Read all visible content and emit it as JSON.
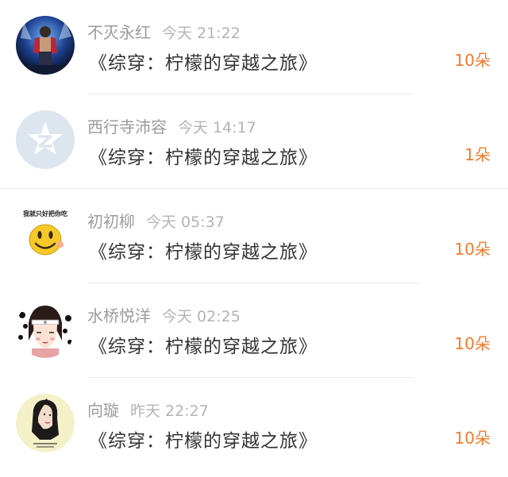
{
  "accent_color": "#f07a2c",
  "items": [
    {
      "avatar_icon": "performer-avatar-icon",
      "name": "不灭永红",
      "time": "今天 21:22",
      "book": "《综穿：柠檬的穿越之旅》",
      "count": "10朵"
    },
    {
      "avatar_icon": "default-star-avatar-icon",
      "name": "西行寺沛容",
      "time": "今天 14:17",
      "book": "《综穿：柠檬的穿越之旅》",
      "count": "1朵"
    },
    {
      "avatar_icon": "smiley-avatar-icon",
      "avatar_caption": "我就只好把你吃",
      "name": "初初柳",
      "time": "今天 05:37",
      "book": "《综穿：柠檬的穿越之旅》",
      "count": "10朵"
    },
    {
      "avatar_icon": "cartoon-girl-avatar-icon",
      "name": "水桥悦洋",
      "time": "今天 02:25",
      "book": "《综穿：柠檬的穿越之旅》",
      "count": "10朵"
    },
    {
      "avatar_icon": "girl-portrait-avatar-icon",
      "name": "向璇",
      "time": "昨天 22:27",
      "book": "《综穿：柠檬的穿越之旅》",
      "count": "10朵"
    }
  ]
}
